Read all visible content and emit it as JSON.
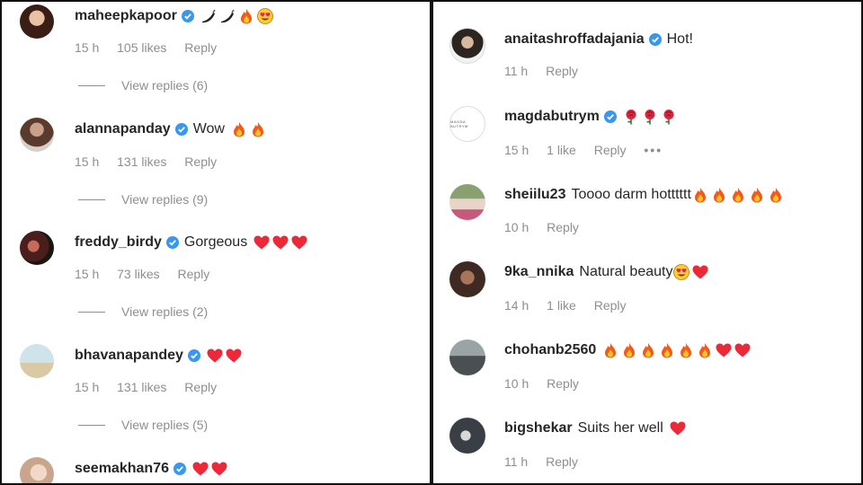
{
  "left_comments": [
    {
      "username": "maheepkapoor",
      "text": "",
      "emojis": [
        "chili",
        "chili",
        "fire",
        "heart-eyes"
      ],
      "time": "15 h",
      "likes": "105 likes",
      "reply": "Reply",
      "view_replies": "View replies (6)"
    },
    {
      "username": "alannapanday",
      "text": "Wow",
      "emojis": [
        "fire",
        "fire"
      ],
      "time": "15 h",
      "likes": "131 likes",
      "reply": "Reply",
      "view_replies": "View replies (9)"
    },
    {
      "username": "freddy_birdy",
      "text": "Gorgeous",
      "emojis": [
        "heart",
        "heart",
        "heart"
      ],
      "time": "15 h",
      "likes": "73 likes",
      "reply": "Reply",
      "view_replies": "View replies (2)"
    },
    {
      "username": "bhavanapandey",
      "text": "",
      "emojis": [
        "heart",
        "heart"
      ],
      "time": "15 h",
      "likes": "131 likes",
      "reply": "Reply",
      "view_replies": "View replies (5)"
    },
    {
      "username": "seemakhan76",
      "text": "",
      "emojis": [
        "heart",
        "heart"
      ]
    }
  ],
  "right_comments": [
    {
      "username": "anaitashroffadajania",
      "text": "Hot!",
      "emojis": [],
      "time": "11 h",
      "likes": "",
      "reply": "Reply"
    },
    {
      "username": "magdabutrym",
      "text": "",
      "emojis": [
        "rose",
        "rose",
        "rose"
      ],
      "time": "15 h",
      "likes": "1 like",
      "reply": "Reply",
      "more": "•••",
      "avatar_text": "MAGDA BUTRYM"
    },
    {
      "username": "sheiilu23",
      "text": "Toooo darm hotttttt",
      "emojis": [
        "fire",
        "fire",
        "fire",
        "fire",
        "fire"
      ],
      "time": "10 h",
      "likes": "",
      "reply": "Reply",
      "inline": true
    },
    {
      "username": "9ka_nnika",
      "text": "Natural beauty",
      "emojis": [
        "heart-eyes",
        "heart"
      ],
      "time": "14 h",
      "likes": "1 like",
      "reply": "Reply",
      "inline": true
    },
    {
      "username": "chohanb2560",
      "text": "",
      "emojis": [
        "fire",
        "fire",
        "fire",
        "fire",
        "fire",
        "fire",
        "heart",
        "heart"
      ],
      "time": "10 h",
      "likes": "",
      "reply": "Reply"
    },
    {
      "username": "bigshekar",
      "text": "Suits her well",
      "emojis": [
        "heart"
      ],
      "time": "11 h",
      "likes": "",
      "reply": "Reply"
    }
  ],
  "colors": {
    "verified": "#3897f0",
    "heart": "#ed2939",
    "muted": "#8e8e8e"
  }
}
